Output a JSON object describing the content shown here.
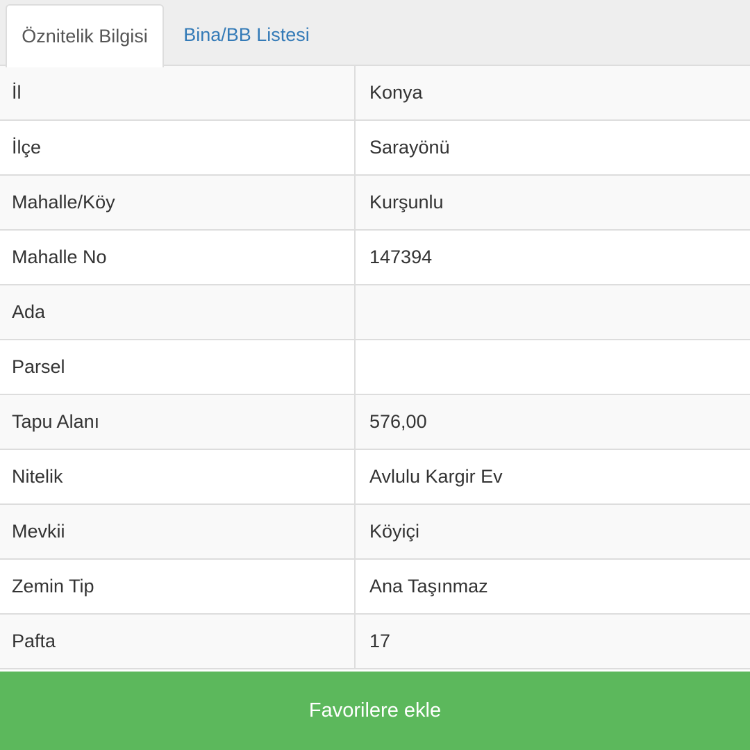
{
  "tabs": [
    {
      "label": "Öznitelik Bilgisi",
      "active": true
    },
    {
      "label": "Bina/BB Listesi",
      "active": false
    }
  ],
  "attributes": [
    {
      "key": "İl",
      "value": "Konya"
    },
    {
      "key": "İlçe",
      "value": "Sarayönü"
    },
    {
      "key": "Mahalle/Köy",
      "value": "Kurşunlu"
    },
    {
      "key": "Mahalle No",
      "value": "147394"
    },
    {
      "key": "Ada",
      "value": ""
    },
    {
      "key": "Parsel",
      "value": ""
    },
    {
      "key": "Tapu Alanı",
      "value": "576,00"
    },
    {
      "key": "Nitelik",
      "value": "Avlulu Kargir Ev"
    },
    {
      "key": "Mevkii",
      "value": "Köyiçi"
    },
    {
      "key": "Zemin Tip",
      "value": "Ana Taşınmaz"
    },
    {
      "key": "Pafta",
      "value": "17"
    }
  ],
  "favorite_button": {
    "label": "Favorilere ekle"
  },
  "colors": {
    "tab_link": "#337ab7",
    "button_bg": "#5cb85c",
    "row_stripe": "#f9f9f9",
    "border": "#dddddd"
  }
}
